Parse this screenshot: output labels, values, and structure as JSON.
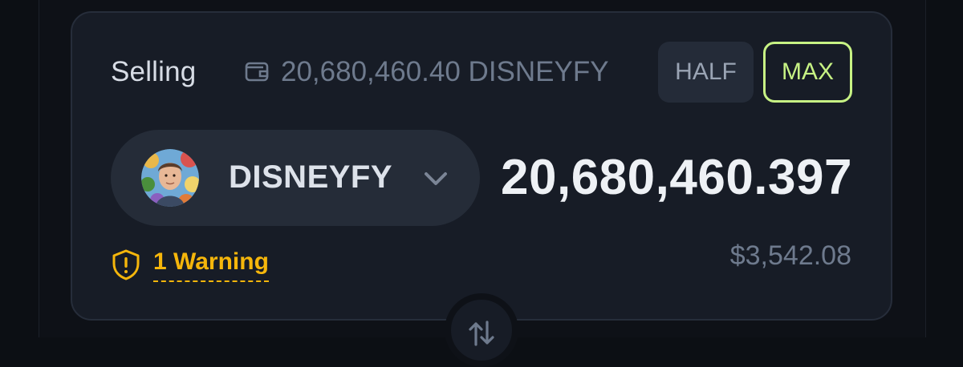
{
  "selling": {
    "label": "Selling",
    "wallet_icon": "wallet-icon",
    "balance": "20,680,460.40 DISNEYFY",
    "half_label": "HALF",
    "max_label": "MAX"
  },
  "token": {
    "symbol": "DISNEYFY",
    "avatar_icon": "token-avatar",
    "chevron_icon": "chevron-down-icon"
  },
  "amount": {
    "value": "20,680,460.397",
    "usd_value": "$3,542.08"
  },
  "warning": {
    "icon": "shield-alert-icon",
    "text": "1 Warning"
  },
  "swap": {
    "icon": "swap-arrows-icon"
  },
  "colors": {
    "background": "#0e1117",
    "card": "#171c26",
    "accent": "#c7f284",
    "warning": "#f5b60b",
    "muted": "#6e7a8d"
  }
}
